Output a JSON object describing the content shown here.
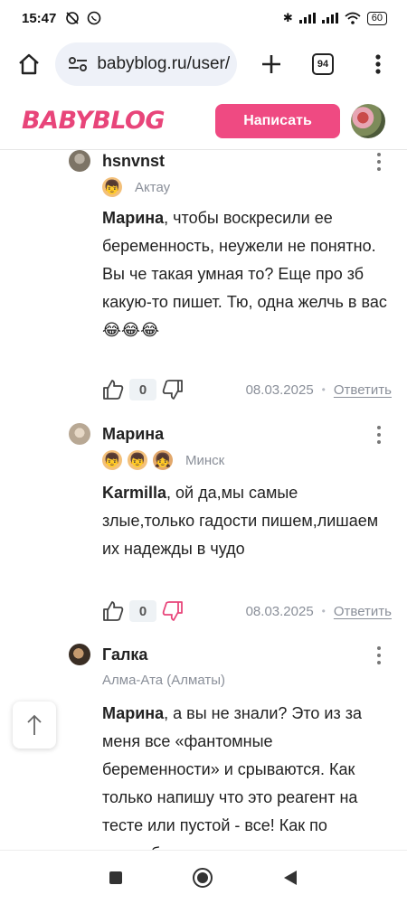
{
  "status_bar": {
    "time": "15:47",
    "battery": "60"
  },
  "browser": {
    "url": "babyblog.ru/user/",
    "tab_count": "94"
  },
  "header": {
    "logo": "BABYBLOG",
    "write_button": "Написать",
    "colors": {
      "logo": "#e8457a",
      "button": "#ef4a82"
    }
  },
  "comments": [
    {
      "author": "hsnvnst",
      "badges": [
        "boy"
      ],
      "city": "Актау",
      "mention": "Марина",
      "text": ", чтобы воскресили ее беременность, неужели не понятно. Вы че такая умная то? Еще про зб какую-то пишет. Тю, одна желчь в вас",
      "emoji": "😂😂😂",
      "votes": "0",
      "date": "08.03.2025",
      "reply": "Ответить"
    },
    {
      "author": "Марина",
      "badges": [
        "boy",
        "boy",
        "girl"
      ],
      "city": "Минск",
      "mention": "Karmilla",
      "text": ", ой да,мы самые злые,только гадости пишем,лишаем их надежды в чудо",
      "votes": "0",
      "date": "08.03.2025",
      "reply": "Ответить"
    },
    {
      "author": "Галка",
      "badges": [],
      "city": "Алма-Ата (Алматы)",
      "mention": "Марина",
      "text": ", а вы не знали? Это из за меня все «фантомные беременности» и срываются. Как только напишу что это реагент на тесте или пустой - все! Как по волшебству"
    }
  ]
}
